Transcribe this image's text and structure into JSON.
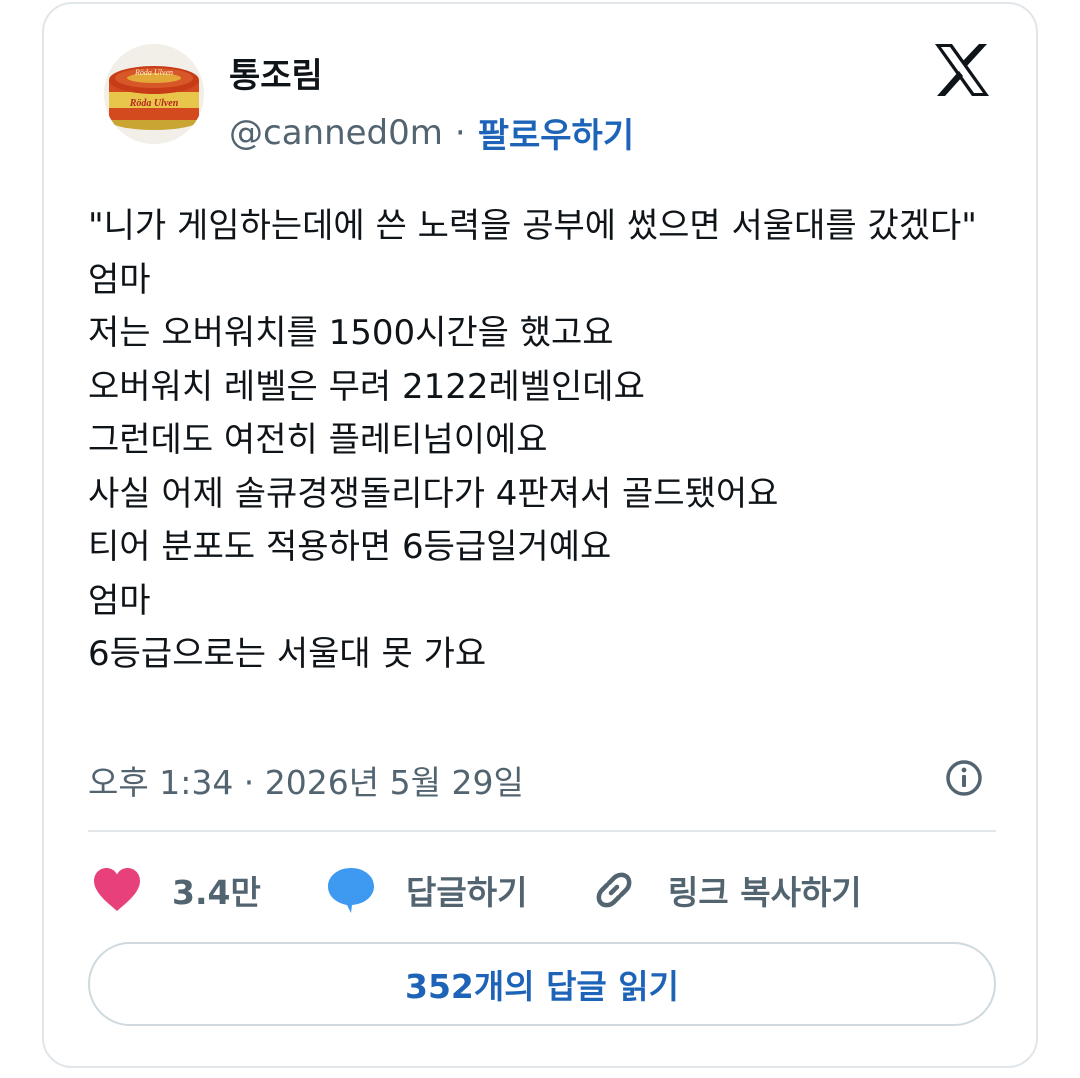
{
  "author": {
    "display_name": "통조림",
    "handle": "@canned0m",
    "separator": "·",
    "follow_label": "팔로우하기",
    "avatar_text_top": "Röda Ulven",
    "avatar_text_bottom": "Röda Ulven"
  },
  "platform_icon": "x-logo-icon",
  "tweet": {
    "text": "\"니가 게임하는데에 쓴 노력을 공부에 썼으면 서울대를 갔겠다\"\n엄마\n저는 오버워치를 1500시간을 했고요\n오버워치 레벨은 무려 2122레벨인데요\n그런데도 여전히 플레티넘이에요\n사실 어제 솔큐경쟁돌리다가 4판져서 골드됐어요\n티어 분포도 적용하면 6등급일거예요\n엄마\n6등급으로는 서울대 못 가요"
  },
  "meta": {
    "timestamp": "오후 1:34 · 2026년 5월 29일",
    "info_icon": "info-icon"
  },
  "actions": {
    "like_count": "3.4만",
    "reply_label": "답글하기",
    "copy_link_label": "링크 복사하기"
  },
  "read_replies_label": "352개의 답글 읽기",
  "colors": {
    "accent": "#1d64b8",
    "like_heart": "#e8407a",
    "reply_bubble": "#3d9af0",
    "muted_text": "#536471",
    "border": "#e1e6ea"
  }
}
